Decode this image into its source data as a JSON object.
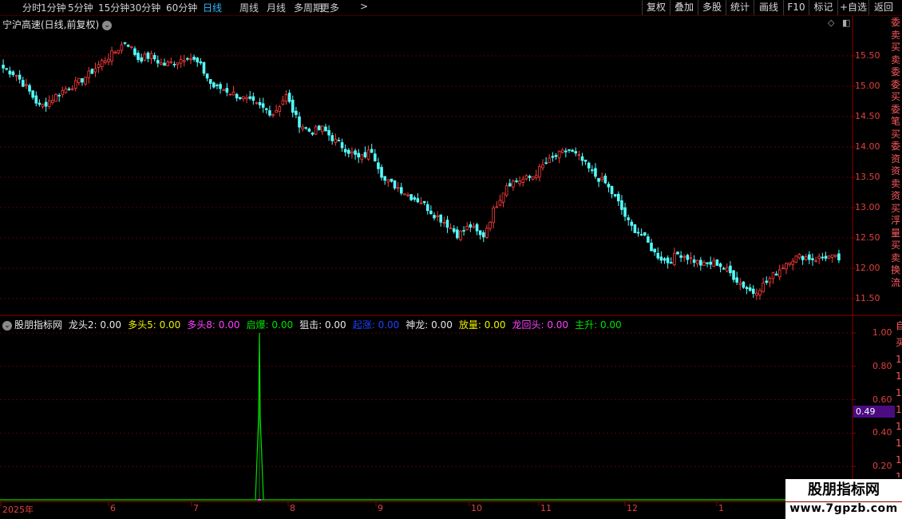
{
  "toolbar": {
    "periods": [
      "分时",
      "1分钟",
      "5分钟",
      "15分钟",
      "30分钟",
      "60分钟",
      "日线",
      "周线",
      "月线",
      "多周期",
      "更多"
    ],
    "active_period": "日线",
    "more_arrow": ">",
    "buttons": [
      "复权",
      "叠加",
      "多股",
      "统计",
      "画线",
      "F10",
      "标记",
      "+自选",
      "返回"
    ]
  },
  "main_chart": {
    "title": "宁沪高速(日线,前复权)",
    "price_axis": [
      "15.50",
      "15.00",
      "14.50",
      "14.00",
      "13.50",
      "13.00",
      "12.50",
      "12.00",
      "11.50"
    ],
    "right_panel_text": "委卖买卖委委买委笔买委资资卖资买浮量买卖换流"
  },
  "indicator": {
    "name": "股朋指标网",
    "items": [
      {
        "label": "龙头2",
        "value": "0.00",
        "color": "#e8e8e8"
      },
      {
        "label": "多头5",
        "value": "0.00",
        "color": "#f0f000"
      },
      {
        "label": "多头8",
        "value": "0.00",
        "color": "#ff40ff"
      },
      {
        "label": "启爆",
        "value": "0.00",
        "color": "#00e000"
      },
      {
        "label": "狙击",
        "value": "0.00",
        "color": "#e8e8e8"
      },
      {
        "label": "起涨",
        "value": "0.00",
        "color": "#2040ff"
      },
      {
        "label": "神龙",
        "value": "0.00",
        "color": "#e8e8e8"
      },
      {
        "label": "放量",
        "value": "0.00",
        "color": "#f0f000"
      },
      {
        "label": "龙回头",
        "value": "0.00",
        "color": "#ff40ff"
      },
      {
        "label": "主升",
        "value": "0.00",
        "color": "#00e000"
      }
    ],
    "axis": [
      "1.00",
      "0.80",
      "0.60",
      "0.40",
      "0.20"
    ],
    "current_value": "0.49",
    "right_panel_text": "自买1111111111"
  },
  "x_axis": [
    "2025年",
    "6",
    "7",
    "8",
    "9",
    "10",
    "11",
    "12",
    "1"
  ],
  "watermark": {
    "title": "股朋指标网",
    "url": "www.7gpzb.com"
  },
  "colors": {
    "up": "#ff3c3c",
    "down": "#54ffff",
    "grid": "#5a0000",
    "signal": "#00dd00"
  },
  "chart_data": {
    "type": "candlestick",
    "title": "宁沪高速(日线,前复权)",
    "x_ticks": [
      "2025年",
      "6",
      "7",
      "8",
      "9",
      "10",
      "11",
      "12",
      "1"
    ],
    "y_ticks": [
      15.5,
      15.0,
      14.5,
      14.0,
      13.5,
      13.0,
      12.5,
      12.0,
      11.5
    ],
    "ylim": [
      11.25,
      15.95
    ],
    "close_approx": [
      15.3,
      15.2,
      14.95,
      14.65,
      14.8,
      14.95,
      15.05,
      15.2,
      15.4,
      15.55,
      15.75,
      15.45,
      15.5,
      15.35,
      15.4,
      15.5,
      15.35,
      15.0,
      14.95,
      14.85,
      14.75,
      14.65,
      14.55,
      14.85,
      14.4,
      14.25,
      14.3,
      14.1,
      13.95,
      13.8,
      13.95,
      13.45,
      13.35,
      13.2,
      13.1,
      12.9,
      12.75,
      12.55,
      12.7,
      12.5,
      13.0,
      13.4,
      13.45,
      13.5,
      13.7,
      13.85,
      13.95,
      13.8,
      13.55,
      13.4,
      13.1,
      12.7,
      12.55,
      12.25,
      12.1,
      12.25,
      12.15,
      12.05,
      12.1,
      11.95,
      11.75,
      11.6,
      11.75,
      11.95,
      12.15,
      12.2,
      12.15,
      12.2,
      12.15
    ],
    "indicator": {
      "name": "股朋指标网",
      "ylim": [
        0,
        1.05
      ],
      "y_ticks": [
        1.0,
        0.8,
        0.6,
        0.4,
        0.2
      ],
      "spike": {
        "month": "7",
        "value": 1.0
      },
      "baseline": 0.0,
      "current_value": 0.49
    }
  }
}
